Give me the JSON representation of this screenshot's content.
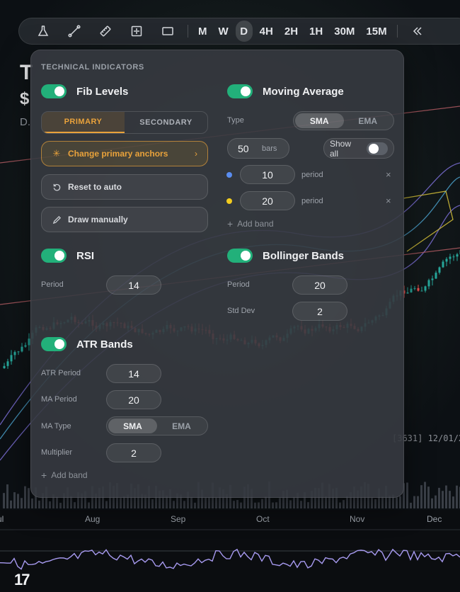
{
  "chart_bg": {
    "title_fragment": "T",
    "price_fragment": "$",
    "sub_fragment": "D.",
    "bar_readout": "[3631] 12/01/2",
    "months": [
      "ul",
      "Aug",
      "Sep",
      "Oct",
      "Nov",
      "Dec"
    ],
    "logo": "17"
  },
  "toolbar": {
    "tools": [
      "flask-icon",
      "trendline-icon",
      "ruler-icon",
      "measure-icon",
      "rectangle-icon"
    ],
    "timeframes": [
      "M",
      "W",
      "D",
      "4H",
      "2H",
      "1H",
      "30M",
      "15M"
    ],
    "active_timeframe": "D",
    "rewind_icon": "rewind-icon"
  },
  "panel": {
    "title": "TECHNICAL INDICATORS",
    "fib": {
      "name": "Fib Levels",
      "tabs": [
        "PRIMARY",
        "SECONDARY"
      ],
      "selected_tab": "PRIMARY",
      "change_anchors": "Change primary anchors",
      "reset": "Reset to auto",
      "draw": "Draw manually"
    },
    "ma": {
      "name": "Moving Average",
      "type_label": "Type",
      "type_options": [
        "SMA",
        "EMA"
      ],
      "type_selected": "SMA",
      "bars_value": "50",
      "bars_unit": "bars",
      "show_all": "Show all",
      "bands": [
        {
          "value": "10",
          "unit": "period",
          "color": "#5a8df0"
        },
        {
          "value": "20",
          "unit": "period",
          "color": "#f2cc1f"
        }
      ],
      "add_band": "Add band"
    },
    "rsi": {
      "name": "RSI",
      "period_label": "Period",
      "period": "14"
    },
    "bb": {
      "name": "Bollinger Bands",
      "period_label": "Period",
      "period": "20",
      "stddev_label": "Std Dev",
      "stddev": "2"
    },
    "atr": {
      "name": "ATR Bands",
      "atr_period_label": "ATR Period",
      "atr_period": "14",
      "ma_period_label": "MA Period",
      "ma_period": "20",
      "ma_type_label": "MA Type",
      "ma_type_options": [
        "SMA",
        "EMA"
      ],
      "ma_type_selected": "SMA",
      "multiplier_label": "Multiplier",
      "multiplier": "2",
      "add_band": "Add band"
    }
  },
  "colors": {
    "accent_green": "#22b07a",
    "accent_orange": "#e9a23b",
    "up_candle": "#26a69a",
    "down_candle": "#ef5350"
  }
}
